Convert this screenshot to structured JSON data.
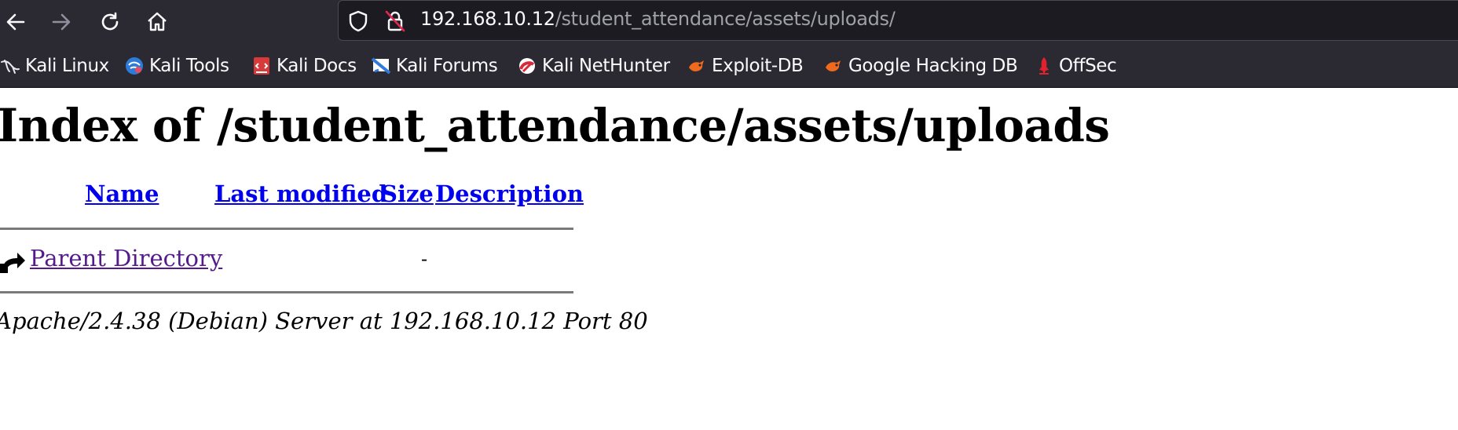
{
  "browser": {
    "url_host": "192.168.10.12",
    "url_path": "/student_attendance/assets/uploads/"
  },
  "bookmarks": [
    {
      "label": "Kali Linux",
      "icon": "kali-dragon-icon"
    },
    {
      "label": "Kali Tools",
      "icon": "kali-tools-icon"
    },
    {
      "label": "Kali Docs",
      "icon": "kali-docs-icon"
    },
    {
      "label": "Kali Forums",
      "icon": "kali-forums-icon"
    },
    {
      "label": "Kali NetHunter",
      "icon": "kali-nethunter-icon"
    },
    {
      "label": "Exploit-DB",
      "icon": "exploit-db-icon"
    },
    {
      "label": "Google Hacking DB",
      "icon": "ghdb-icon"
    },
    {
      "label": "OffSec",
      "icon": "offsec-icon"
    }
  ],
  "page": {
    "title": "Index of /student_attendance/assets/uploads",
    "columns": {
      "name": "Name",
      "last_modified": "Last modified",
      "size": "Size",
      "description": "Description"
    },
    "rows": [
      {
        "name": "Parent Directory",
        "size": "-"
      }
    ],
    "footer": "Apache/2.4.38 (Debian) Server at 192.168.10.12 Port 80"
  },
  "colors": {
    "link": "#0000ee",
    "visited_link": "#551a8b",
    "chrome_bg": "#2b2a33"
  }
}
